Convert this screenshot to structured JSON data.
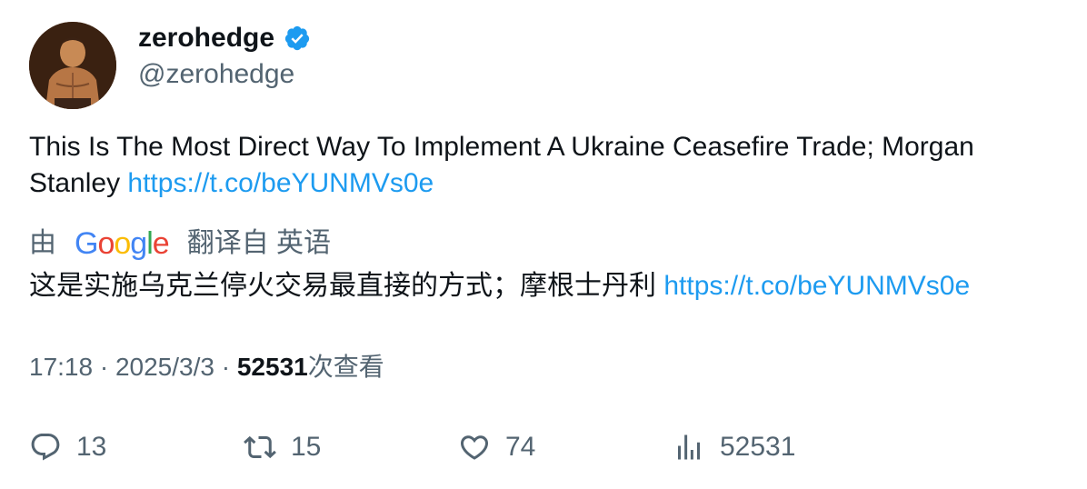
{
  "author": {
    "display_name": "zerohedge",
    "handle": "@zerohedge",
    "verified": true,
    "verified_color": "#1d9bf0"
  },
  "tweet": {
    "text": "This Is The Most Direct Way To Implement A Ukraine Ceasefire Trade; Morgan Stanley ",
    "link": "https://t.co/beYUNMVs0e"
  },
  "translation": {
    "prefix": "由",
    "provider_letters": [
      "G",
      "o",
      "o",
      "g",
      "l",
      "e"
    ],
    "suffix": "翻译自 英语",
    "text": "这是实施乌克兰停火交易最直接的方式；摩根士丹利 ",
    "link": "https://t.co/beYUNMVs0e"
  },
  "meta": {
    "time": "17:18",
    "separator": " · ",
    "date": "2025/3/3",
    "views": "52531",
    "views_label": "次查看"
  },
  "actions": {
    "replies": "13",
    "retweets": "15",
    "likes": "74",
    "views": "52531"
  },
  "colors": {
    "text": "#0f1419",
    "secondary": "#536471",
    "link": "#1d9bf0"
  },
  "icons": [
    "verified-badge-icon",
    "reply-icon",
    "retweet-icon",
    "like-icon",
    "views-icon"
  ]
}
